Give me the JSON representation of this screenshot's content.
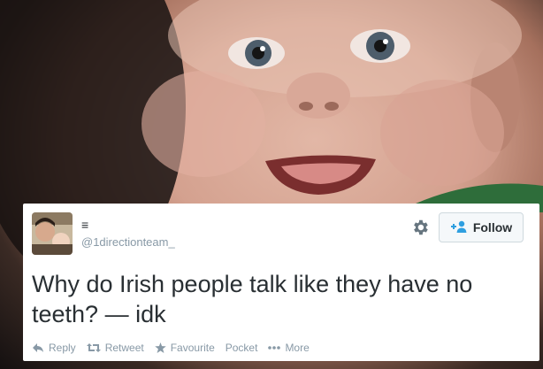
{
  "tweet": {
    "display_name": "≡",
    "handle": "@1directionteam_",
    "text": "Why do Irish people talk like they have no teeth? — idk",
    "follow_label": "Follow",
    "actions": {
      "reply": "Reply",
      "retweet": "Retweet",
      "favourite": "Favourite",
      "pocket": "Pocket",
      "more": "More"
    }
  },
  "icons": [
    "gear-icon",
    "follow-person-icon",
    "reply-icon",
    "retweet-icon",
    "favourite-star-icon",
    "more-dots-icon"
  ],
  "colors": {
    "card_background": "#ffffff",
    "text": "#292f33",
    "muted": "#8899a6",
    "accent_blue": "#2f9fe0"
  }
}
